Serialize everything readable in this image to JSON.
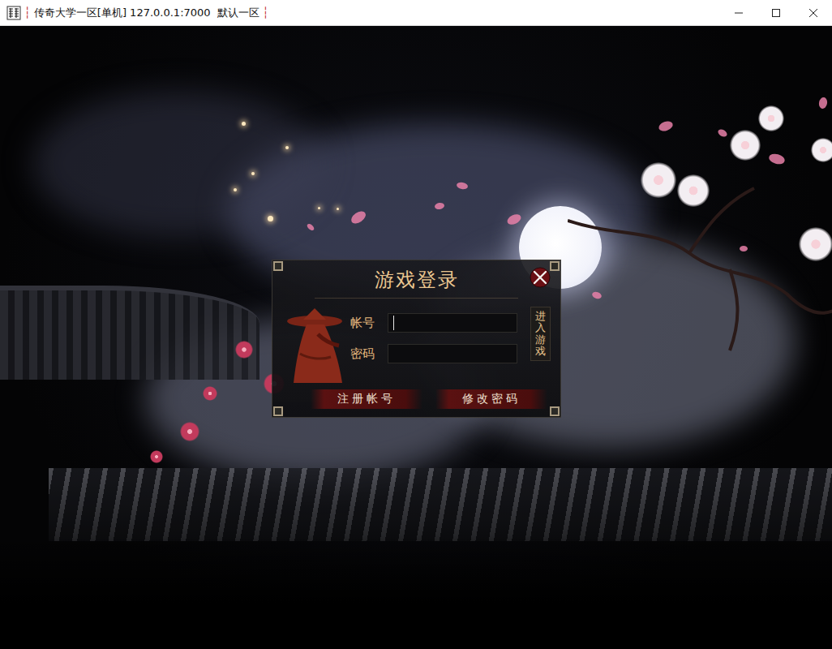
{
  "window": {
    "title": "传奇大学一区[单机] 127.0.0.1:7000  默认一区",
    "title_mark": "┆"
  },
  "login": {
    "title": "游戏登录",
    "fields": [
      {
        "label": "帐号",
        "value": "",
        "focused": true
      },
      {
        "label": "密码",
        "value": "",
        "focused": false
      }
    ],
    "enter_button": "进入游戏",
    "buttons": [
      "注册帐号",
      "修改密码"
    ]
  }
}
